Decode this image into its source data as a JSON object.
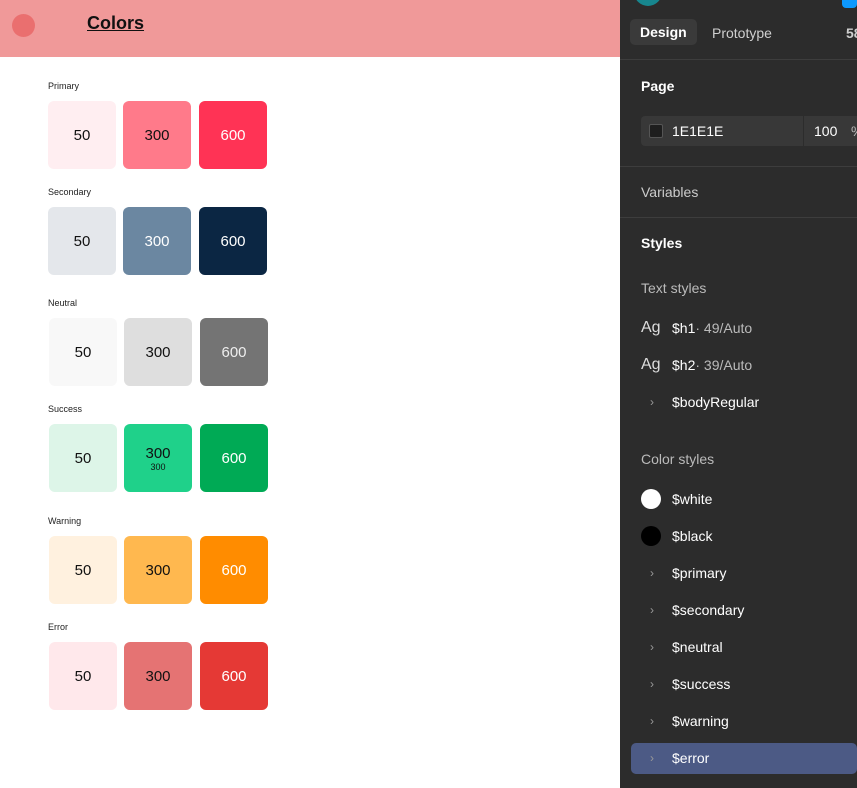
{
  "header": {
    "title": "Colors"
  },
  "groups": [
    {
      "label": "Primary",
      "swatches": [
        {
          "label": "50",
          "bg": "#FFEEF1",
          "fg": "#111"
        },
        {
          "label": "300",
          "bg": "#FF7A8A",
          "fg": "#111"
        },
        {
          "label": "600",
          "bg": "#FF3355",
          "fg": "#fff"
        }
      ]
    },
    {
      "label": "Secondary",
      "swatches": [
        {
          "label": "50",
          "bg": "#E4E7EB",
          "fg": "#111"
        },
        {
          "label": "300",
          "bg": "#6B87A1",
          "fg": "#fff"
        },
        {
          "label": "600",
          "bg": "#0B2643",
          "fg": "#fff"
        }
      ]
    },
    {
      "label": "Neutral",
      "swatches": [
        {
          "label": "50",
          "bg": "#F8F8F8",
          "fg": "#111"
        },
        {
          "label": "300",
          "bg": "#DEDEDE",
          "fg": "#111"
        },
        {
          "label": "600",
          "bg": "#747474",
          "fg": "#eee"
        }
      ]
    },
    {
      "label": "Success",
      "swatches": [
        {
          "label": "50",
          "bg": "#DDF5E8",
          "fg": "#111"
        },
        {
          "label": "300",
          "bg": "#1FD18A",
          "fg": "#111",
          "sub": "300"
        },
        {
          "label": "600",
          "bg": "#00AA55",
          "fg": "#fff"
        }
      ]
    },
    {
      "label": "Warning",
      "swatches": [
        {
          "label": "50",
          "bg": "#FFF1DF",
          "fg": "#111"
        },
        {
          "label": "300",
          "bg": "#FFB84F",
          "fg": "#111"
        },
        {
          "label": "600",
          "bg": "#FF8C00",
          "fg": "#fff"
        }
      ]
    },
    {
      "label": "Error",
      "swatches": [
        {
          "label": "50",
          "bg": "#FFE8EB",
          "fg": "#111"
        },
        {
          "label": "300",
          "bg": "#E57373",
          "fg": "#111"
        },
        {
          "label": "600",
          "bg": "#E53935",
          "fg": "#fff"
        }
      ]
    }
  ],
  "panel": {
    "tabs": {
      "design": "Design",
      "prototype": "Prototype",
      "zoom": "58"
    },
    "page": {
      "title": "Page",
      "hex": "1E1E1E",
      "opacity": "100",
      "unit": "%"
    },
    "variables": "Variables",
    "styles": "Styles",
    "text_styles": {
      "title": "Text styles",
      "items": [
        {
          "ag": "Ag",
          "name": "$h1",
          "meta": " · 49/Auto"
        },
        {
          "ag": "Ag",
          "name": "$h2",
          "meta": " · 39/Auto"
        }
      ],
      "group": "$bodyRegular"
    },
    "color_styles": {
      "title": "Color styles",
      "swatches": [
        {
          "name": "$white",
          "color": "#FFFFFF"
        },
        {
          "name": "$black",
          "color": "#000000"
        }
      ],
      "groups": [
        "$primary",
        "$secondary",
        "$neutral",
        "$success",
        "$warning",
        "$error"
      ]
    },
    "chevron": "›"
  }
}
